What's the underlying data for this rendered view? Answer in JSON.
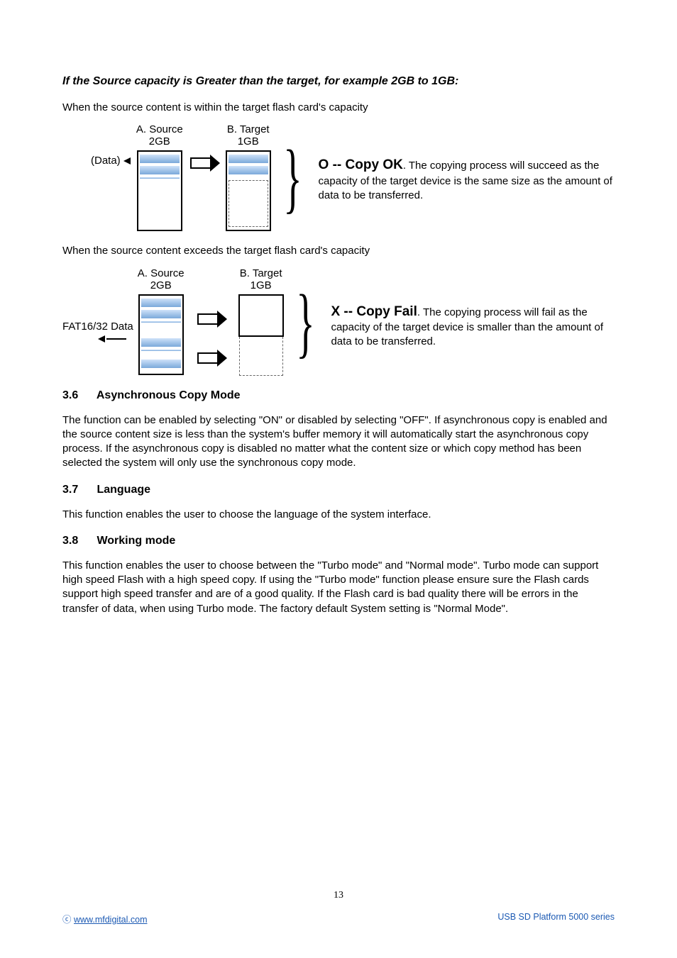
{
  "heading_italic": "If the Source capacity is Greater than the target, for example 2GB to 1GB:",
  "intro1": "When the source content is within the target flash card's capacity",
  "d1": {
    "colA_top": "A.  Source",
    "colA_sub": "2GB",
    "colB_top": "B. Target",
    "colB_sub": "1GB",
    "side_label": "(Data)"
  },
  "result1": {
    "heading": "O -- Copy OK",
    "tail": ".  The copying process will succeed as the capacity of the target device is the same size as the amount of data to be transferred."
  },
  "intro2": "When the source content exceeds the target flash card's capacity",
  "d2": {
    "colA_top": "A. Source",
    "colA_sub": "2GB",
    "colB_top": "B. Target",
    "colB_sub": "1GB",
    "side_label": "FAT16/32 Data"
  },
  "result2": {
    "heading": "X -- Copy Fail",
    "tail": ".  The copying process will fail as the capacity of the target device is smaller than the amount of data to be transferred."
  },
  "sections": {
    "s36_num": "3.6",
    "s36_title": "Asynchronous Copy Mode",
    "s36_body": "The function can be enabled by selecting \"ON\" or disabled by selecting \"OFF\". If asynchronous copy is enabled and the source content size is less than the system's buffer memory it will automatically start the asynchronous copy process. If the asynchronous copy is disabled no matter what the content size or which copy method has been selected the system will only use the synchronous copy mode.",
    "s37_num": "3.7",
    "s37_title": "Language",
    "s37_body": "This function enables the user to choose the language of the system interface.",
    "s38_num": "3.8",
    "s38_title": "Working mode",
    "s38_body": "This function enables the user to choose between the \"Turbo mode\" and \"Normal mode\". Turbo mode can support high speed Flash with a high speed copy. If using the \"Turbo mode\" function please ensure sure the Flash cards support high speed transfer and are of a good quality. If the Flash card is bad quality there will be errors in the transfer of data, when using Turbo mode. The factory default System setting is \"Normal Mode\"."
  },
  "page_number": "13",
  "footer": {
    "copyright": "ⓒ ",
    "url": "www.mfdigital.com",
    "right": "USB SD Platform 5000 series"
  }
}
